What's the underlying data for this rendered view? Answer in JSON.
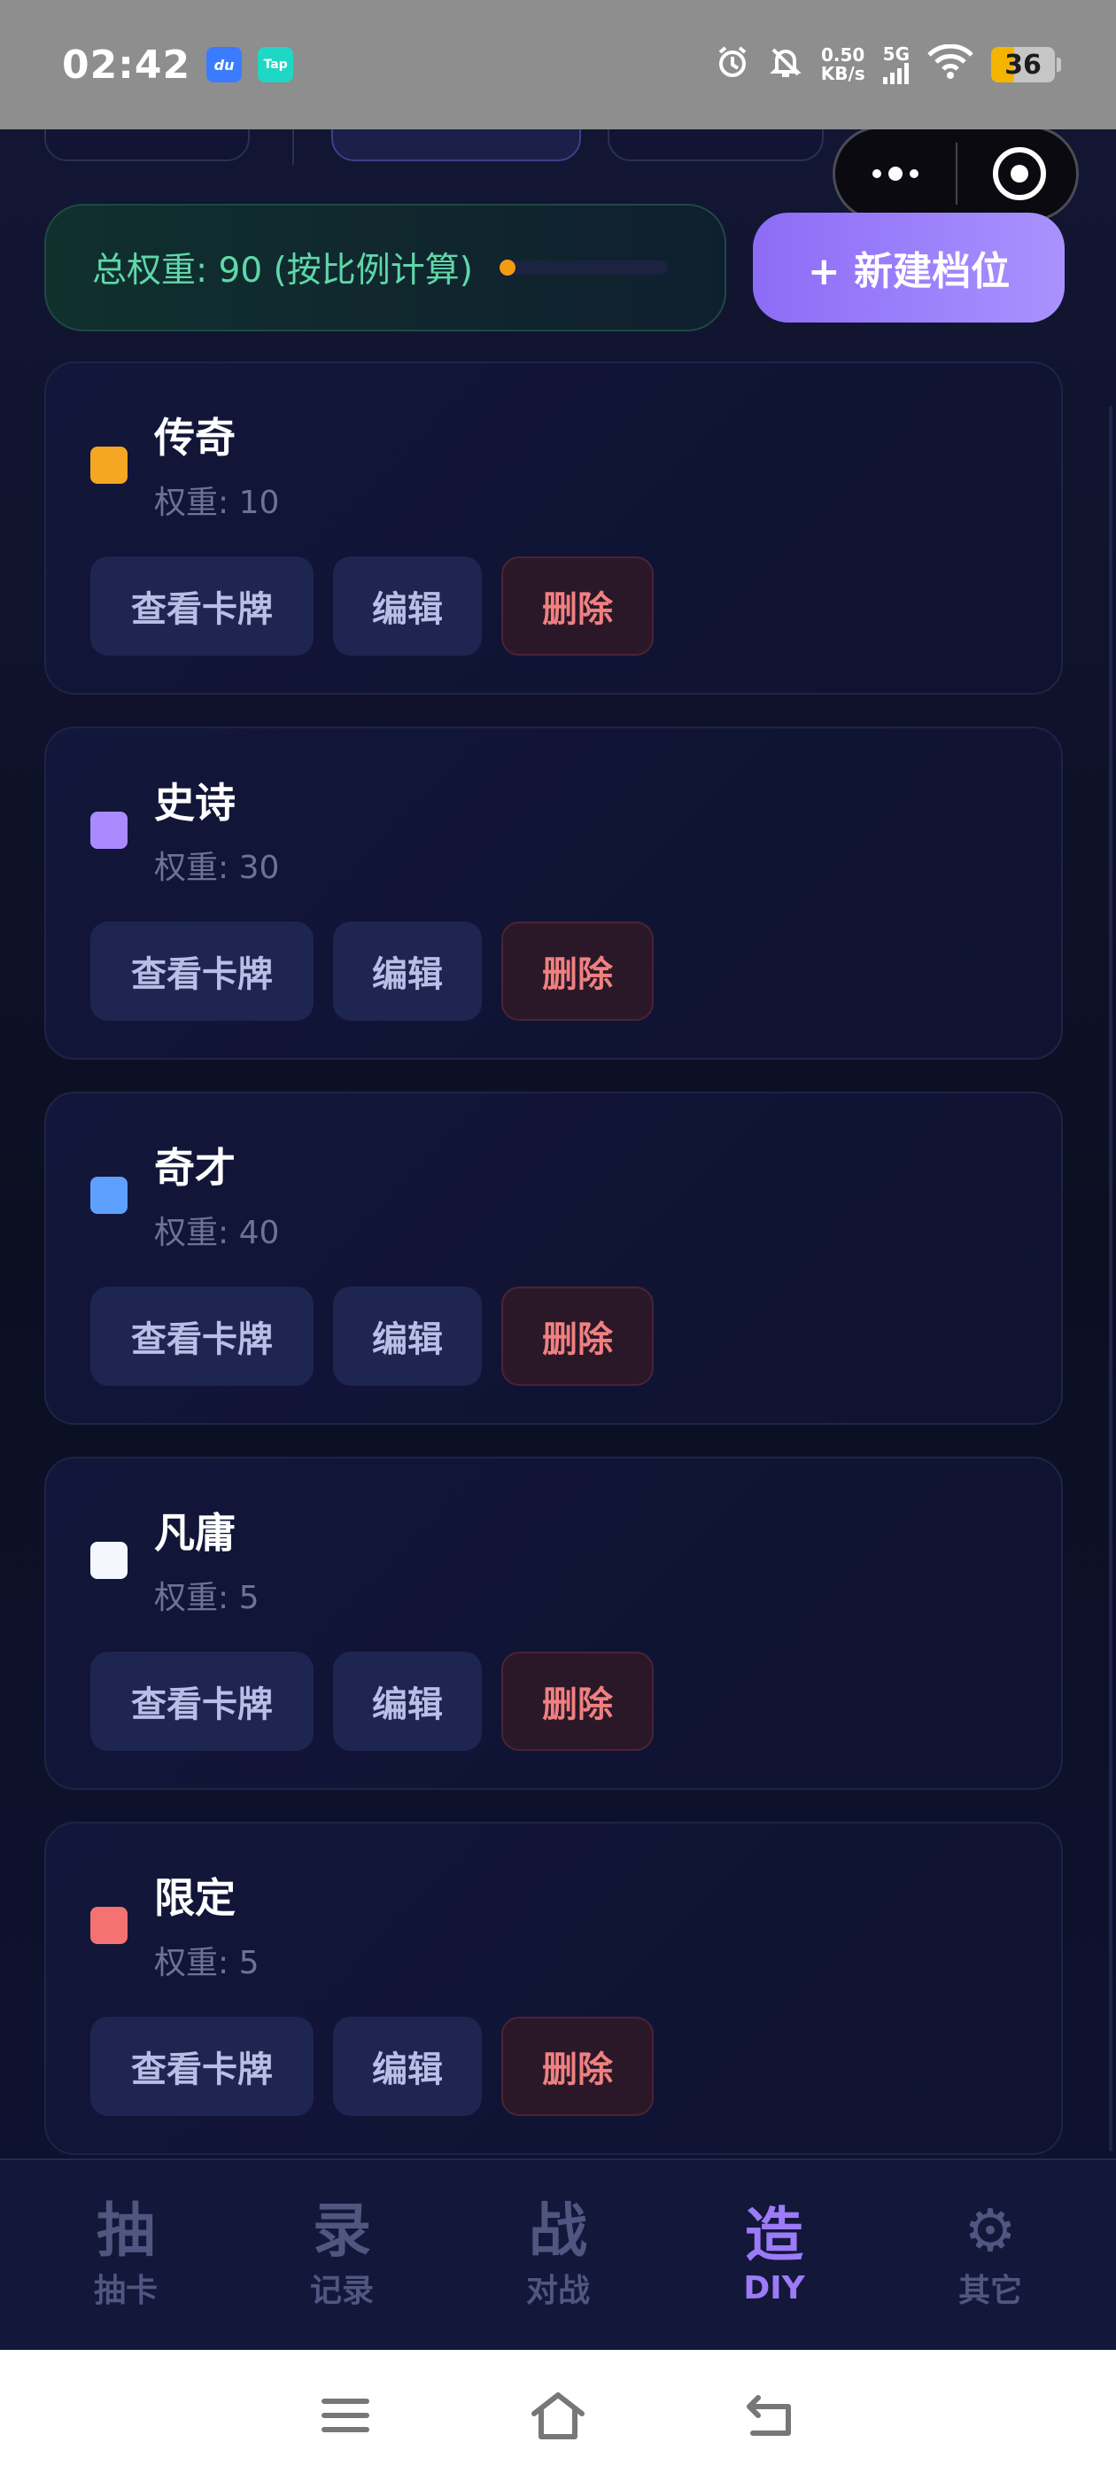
{
  "status_bar": {
    "time": "02:42",
    "app_icon_1": "du",
    "app_icon_2": "Tap",
    "speed_value": "0.50",
    "speed_unit": "KB/s",
    "network": "5G",
    "battery": "36",
    "battery_level": 0.36,
    "icons": [
      "alarm-icon",
      "bell-off-icon",
      "wifi-icon"
    ]
  },
  "summary": {
    "total_weight": "总权重: 90 (按比例计算)",
    "new_tier_button": "+ 新建档位"
  },
  "tier_actions": {
    "view": "查看卡牌",
    "edit": "编辑",
    "delete": "删除"
  },
  "tiers": [
    {
      "name": "传奇",
      "weight": "权重: 10",
      "color": "#f5a623"
    },
    {
      "name": "史诗",
      "weight": "权重: 30",
      "color": "#a98bff"
    },
    {
      "name": "奇才",
      "weight": "权重: 40",
      "color": "#5ea0ff"
    },
    {
      "name": "凡庸",
      "weight": "权重: 5",
      "color": "#f5f7ff"
    },
    {
      "name": "限定",
      "weight": "权重: 5",
      "color": "#f47272"
    }
  ],
  "tab_bar": [
    {
      "glyph": "抽",
      "label": "抽卡"
    },
    {
      "glyph": "录",
      "label": "记录"
    },
    {
      "glyph": "战",
      "label": "对战"
    },
    {
      "glyph": "造",
      "label": "DIY"
    },
    {
      "glyph": "⚙",
      "label": "其它"
    }
  ],
  "colors": {
    "accent": "#9b7bf7",
    "weight_text": "#5fd7a8",
    "delete_text": "#f08080"
  }
}
